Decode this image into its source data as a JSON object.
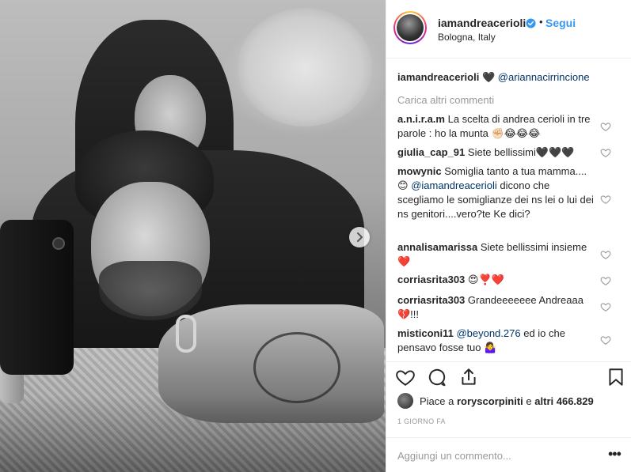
{
  "header": {
    "username": "iamandreacerioli",
    "dot": "•",
    "follow_label": "Segui",
    "location": "Bologna, Italy"
  },
  "caption": {
    "username": "iamandreacerioli",
    "emoji": "🖤",
    "mention": "@ariannacirrincione"
  },
  "load_more_label": "Carica altri commenti",
  "comments": [
    {
      "user": "a.n.i.r.a.m",
      "text": "La scelta di andrea cerioli in tre parole : ho la munta ✊🏻😂😂😂"
    },
    {
      "user": "giulia_cap_91",
      "text": "Siete bellissimi🖤🖤🖤"
    },
    {
      "user": "mowynic",
      "text": "Somiglia tanto a tua mamma....😊",
      "mention": "@iamandreacerioli",
      "text2": "dicono che scegliamo le somiglianze dei ns lei o lui dei ns genitori....vero?te Ke dici?"
    },
    {
      "user": "annalisamarissa",
      "text": "Siete bellissimi insieme ❤️"
    },
    {
      "user": "corriasrita303",
      "text": "😍❣️❤️"
    },
    {
      "user": "corriasrita303",
      "text": "Grandeeeeeee Andreaaa💔!!!"
    },
    {
      "user": "misticoni11",
      "mention": "@beyond.276",
      "text": "ed io che pensavo fosse tuo 🤷‍♀️"
    }
  ],
  "likes": {
    "prefix": "Piace a",
    "first_user": "roryscorpiniti",
    "middle": "e",
    "others": "altri 466.829"
  },
  "time_label": "1 GIORNO FA",
  "add_comment": {
    "placeholder": "Aggiungi un commento..."
  },
  "more_label": "•••",
  "colors": {
    "link": "#3897f0",
    "mention": "#003569",
    "muted": "#999999",
    "text": "#262626"
  }
}
